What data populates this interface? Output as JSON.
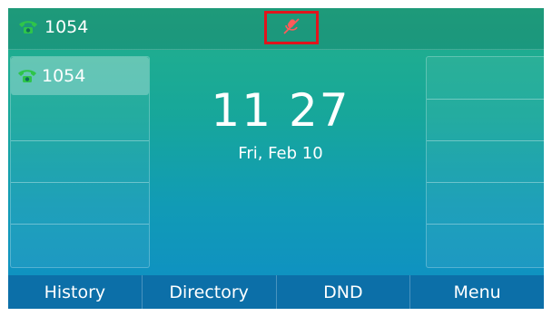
{
  "statusbar": {
    "account_number": "1054",
    "account_icon": "phone-handset-icon",
    "mute_icon": "microphone-muted-icon",
    "mute_highlight_color": "#e1141c"
  },
  "line_keys": {
    "left": [
      {
        "label": "1054",
        "icon": "phone-handset-icon",
        "active": true
      },
      {
        "label": ""
      },
      {
        "label": ""
      },
      {
        "label": ""
      },
      {
        "label": ""
      }
    ],
    "right": [
      {
        "label": ""
      },
      {
        "label": ""
      },
      {
        "label": ""
      },
      {
        "label": ""
      },
      {
        "label": ""
      }
    ]
  },
  "clock": {
    "time": "11 27",
    "date": "Fri, Feb 10"
  },
  "softkeys": [
    {
      "label": "History"
    },
    {
      "label": "Directory"
    },
    {
      "label": "DND"
    },
    {
      "label": "Menu"
    }
  ],
  "colors": {
    "accent_green": "#2ec54a",
    "softkey_bar": "#0c6fa8"
  }
}
